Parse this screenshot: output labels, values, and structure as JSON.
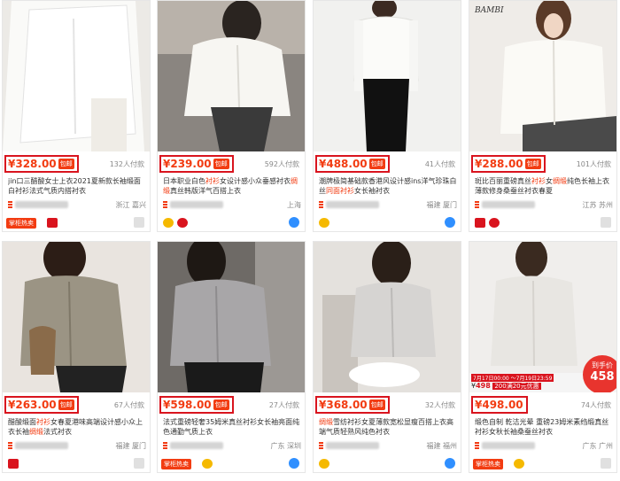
{
  "colors": {
    "accent": "#f23c12",
    "frame": "#d9141e"
  },
  "products": [
    {
      "price": "¥328.00",
      "tag": "包邮",
      "sold": "132人付款",
      "title": "jin口三醋酸女士上衣2021夏新款长袖缎面白衬衫法式气质内搭衬衣",
      "location": "浙江 嘉兴",
      "badge": "掌柜热卖"
    },
    {
      "price": "¥239.00",
      "tag": "包邮",
      "sold": "592人付款",
      "title_pre": "日本职业白色",
      "title_hl1": "衬衫",
      "title_mid": "女设计感小众垂感衬衣",
      "title_hl2": "绸缎",
      "title_post": "真丝韩版洋气百搭上衣",
      "location": "上海"
    },
    {
      "price": "¥488.00",
      "tag": "包邮",
      "sold": "41人付款",
      "title_pre": "潮牌极简基础款香港风设计感ins洋气珍珠白丝",
      "title_hl1": "同面",
      "title_mid": "衬衫",
      "title_hl2": "女长袖衬衣",
      "title_post": "",
      "location": "福建 厦门"
    },
    {
      "price": "¥288.00",
      "tag": "包邮",
      "sold": "101人付款",
      "title_pre": "斑比百丽重磅真丝",
      "title_hl1": "衬衫",
      "title_mid": "女",
      "title_hl2": "绸缎",
      "title_post": "纯色长袖上衣薄款修身桑蚕丝衬衣春夏",
      "location": "江苏 苏州",
      "brandmark": "BAMBI"
    },
    {
      "price": "¥263.00",
      "tag": "包邮",
      "sold": "67人付款",
      "title_pre": "醋酸缎面",
      "title_hl1": "衬衫",
      "title_mid": "女春夏港味高端设计感小众上衣长袖",
      "title_hl2": "绸缎",
      "title_post": "法式衬衣",
      "location": "福建 厦门"
    },
    {
      "price": "¥598.00",
      "tag": "包邮",
      "sold": "27人付款",
      "title_pre": "法式重磅轻奢35姆米真丝衬衫女长袖亮面纯色通勤气质上衣",
      "title_hl1": "",
      "title_mid": "",
      "title_hl2": "",
      "title_post": "",
      "location": "广东 深圳",
      "badge": "掌柜热卖"
    },
    {
      "price": "¥368.00",
      "tag": "包邮",
      "sold": "32人付款",
      "title_pre": "绸缎",
      "title_hl1": "",
      "title_mid": "雪纺衬衫女夏薄款宽松显瘦百搭上衣高端气质轻熟风纯色衬衣",
      "title_hl2": "",
      "title_post": "",
      "location": "福建 福州"
    },
    {
      "price": "¥498.00",
      "tag": "",
      "sold": "74人付款",
      "title_pre": "缎色自制 乾洁光晕 重磅23姆米素绉缎真丝衬衫女秋长袖桑蚕丝衬衣",
      "title_hl1": "",
      "title_mid": "",
      "title_hl2": "",
      "title_post": "",
      "location": "广东 广州",
      "badge": "掌柜热卖",
      "promo_date": "7月17日00:00 ～7月19日23:59",
      "promo_price": "498",
      "promo_coupon": "200满20元优惠",
      "bubble_top": "到手价",
      "bubble_price": "458"
    }
  ]
}
